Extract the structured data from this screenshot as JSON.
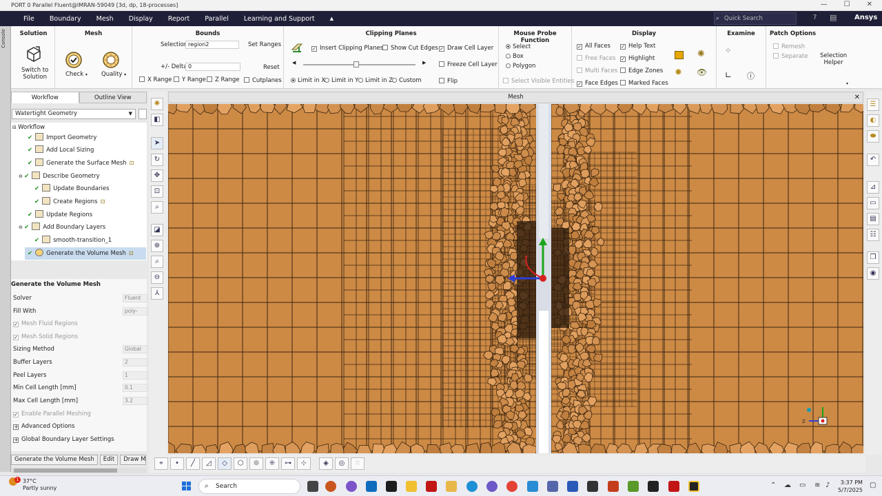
{
  "window": {
    "title": "PORT 0 Parallel Fluent@IMRAN-59049  [3d, dp, 18-processes]",
    "controls": [
      "—",
      "☐",
      "✕"
    ]
  },
  "menu": {
    "items": [
      "File",
      "Boundary",
      "Mesh",
      "Display",
      "Report",
      "Parallel",
      "Learning and Support"
    ],
    "collapse": "▲",
    "search_placeholder": "Quick Search",
    "brand": "Ansys"
  },
  "ribbon": {
    "solution": {
      "title": "Solution",
      "switch_label_1": "Switch to",
      "switch_label_2": "Solution"
    },
    "mesh": {
      "title": "Mesh",
      "check": "Check",
      "quality": "Quality"
    },
    "bounds": {
      "title": "Bounds",
      "selection_label": "Selection",
      "selection_value": "region2",
      "set_ranges": "Set Ranges",
      "delta_label": "+/- Delta",
      "delta_value": "0",
      "reset": "Reset",
      "x_range": "X Range",
      "y_range": "Y Range",
      "z_range": "Z Range",
      "cutplanes": "Cutplanes"
    },
    "clipping": {
      "title": "Clipping Planes",
      "insert": "Insert Clipping Planes",
      "show_cut": "Show Cut Edges",
      "draw_cell": "Draw Cell Layer",
      "freeze": "Freeze Cell Layer",
      "flip": "Flip",
      "limit_x": "Limit in X",
      "limit_y": "Limit in Y",
      "limit_z": "Limit in Z",
      "custom": "Custom",
      "slider_value": 0.47
    },
    "probe": {
      "title": "Mouse Probe Function",
      "select": "Select",
      "box": "Box",
      "polygon": "Polygon",
      "visible": "Select Visible Entities"
    },
    "display": {
      "title": "Display",
      "all_faces": "All Faces",
      "free_faces": "Free Faces",
      "multi_faces": "Multi Faces",
      "face_edges": "Face Edges",
      "help_text": "Help Text",
      "highlight": "Highlight",
      "edge_zones": "Edge Zones",
      "marked_faces": "Marked Faces"
    },
    "examine": {
      "title": "Examine"
    },
    "patch": {
      "title": "Patch Options",
      "remesh": "Remesh",
      "separate": "Separate",
      "helper_1": "Selection",
      "helper_2": "Helper"
    }
  },
  "sidebar_strip": "Console",
  "panel": {
    "tabs": [
      "Workflow",
      "Outline View"
    ],
    "workflow_type": "Watertight Geometry",
    "tree_root": "Workflow",
    "tree": [
      {
        "label": "Import Geometry"
      },
      {
        "label": "Add Local Sizing"
      },
      {
        "label": "Generate the Surface Mesh"
      },
      {
        "label": "Describe Geometry"
      },
      {
        "label": "Update Boundaries"
      },
      {
        "label": "Create Regions"
      },
      {
        "label": "Update Regions"
      },
      {
        "label": "Add Boundary Layers"
      },
      {
        "label": "smooth-transition_1"
      },
      {
        "label": "Generate the Volume Mesh"
      }
    ],
    "props_title": "Generate the Volume Mesh",
    "props": [
      {
        "label": "Solver",
        "value": "Fluent"
      },
      {
        "label": "Fill With",
        "value": "poly-hexcore"
      },
      {
        "label": "Mesh Fluid Regions",
        "value": ""
      },
      {
        "label": "Mesh Solid Regions",
        "value": ""
      },
      {
        "label": "Sizing Method",
        "value": "Global"
      },
      {
        "label": "Buffer Layers",
        "value": "2"
      },
      {
        "label": "Peel Layers",
        "value": "1"
      },
      {
        "label": "Min Cell Length [mm]",
        "value": "0.1"
      },
      {
        "label": "Max Cell Length [mm]",
        "value": "3.2"
      },
      {
        "label": "Enable Parallel Meshing",
        "value": ""
      },
      {
        "label": "Advanced Options",
        "value": ""
      },
      {
        "label": "Global Boundary Layer Settings",
        "value": ""
      }
    ],
    "buttons": [
      "Generate the Volume Mesh",
      "Edit",
      "Draw Mesh"
    ]
  },
  "viewport": {
    "title": "Mesh",
    "close": "✕",
    "mesh_color": "#cd8a45",
    "line_color": "#3a2410"
  },
  "taskbar": {
    "temp": "37°C",
    "weather": "Partly sunny",
    "search": "Search",
    "time": "3:37 PM",
    "date": "5/7/2025",
    "badge": "1"
  },
  "icons": {
    "search": "magnifier-icon",
    "help": "help-circle-icon",
    "book": "book-icon"
  }
}
